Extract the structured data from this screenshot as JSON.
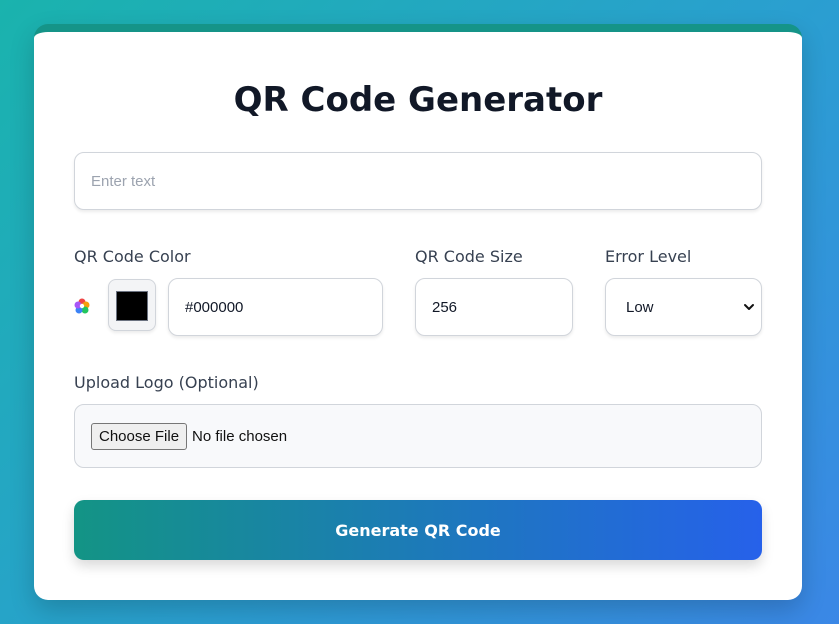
{
  "app": {
    "title": "QR Code Generator"
  },
  "text_input": {
    "placeholder": "Enter text",
    "value": ""
  },
  "color": {
    "label": "QR Code Color",
    "icon": "palette-icon",
    "swatch_color": "#000000",
    "hex_value": "#000000"
  },
  "size": {
    "label": "QR Code Size",
    "value": "256"
  },
  "error_level": {
    "label": "Error Level",
    "selected": "Low"
  },
  "logo": {
    "label": "Upload Logo (Optional)",
    "button_label": "Choose File",
    "status": "No file chosen"
  },
  "generate": {
    "label": "Generate QR Code"
  },
  "theme": {
    "accent_start": "#139485",
    "accent_end": "#2661ea",
    "card_top_border": "#159488"
  }
}
